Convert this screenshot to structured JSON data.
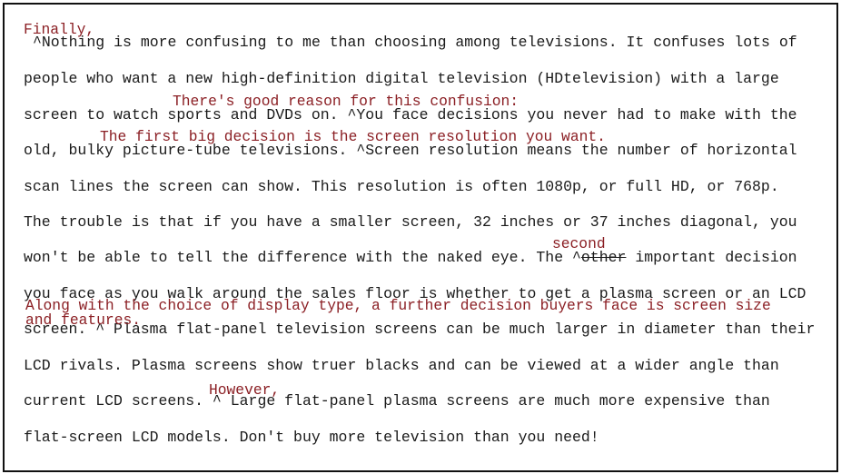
{
  "lines": [
    "^Nothing is more confusing to me than choosing among televisions. It confuses lots of",
    "people who want a new high-definition digital television (HDtelevision) with a large",
    "screen to watch sports and DVDs on. ^You face decisions you never had to make with the",
    "old, bulky picture-tube televisions. ^Screen resolution means the number of horizontal",
    "scan lines the screen can show. This resolution is often 1080p, or full HD, or 768p.",
    "The trouble is that if you have a smaller screen, 32 inches or 37 inches diagonal, you",
    {
      "pre": "won't be able to tell the difference with the naked eye. The ^",
      "struck": "other",
      "post": " important decision"
    },
    "you face as you walk around the sales floor is whether to get a plasma screen or an LCD",
    "screen. ^ Plasma flat-panel television screens can be much larger in diameter than their",
    "LCD rivals. Plasma screens show truer blacks and can be viewed at a wider angle than",
    "current LCD screens. ^ Large flat-panel plasma screens are much more expensive than",
    "flat-screen LCD models. Don't buy more television than you need!"
  ],
  "annotations": {
    "finally": "Finally,",
    "reason": "There's good reason for this confusion:",
    "first_decision": "The first big decision is the screen resolution you want.",
    "second": "second",
    "along_1": "Along with the choice of display type, a further decision buyers face is screen size",
    "along_2": "and features.",
    "however": "However,"
  },
  "colors": {
    "annotation": "#8b1f24",
    "text": "#1a1a1a"
  }
}
